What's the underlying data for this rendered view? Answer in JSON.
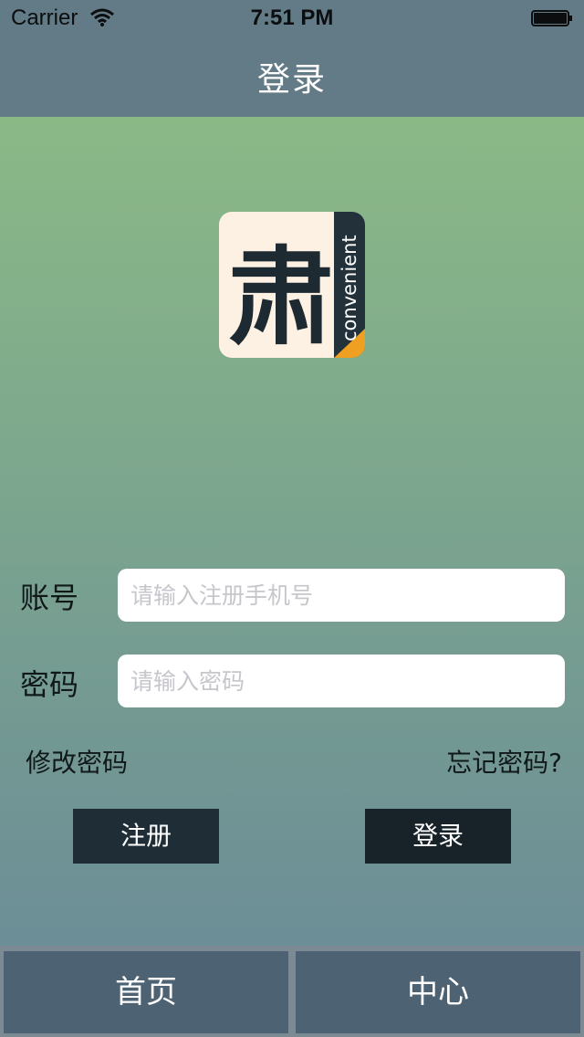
{
  "status_bar": {
    "carrier": "Carrier",
    "time": "7:51 PM"
  },
  "nav": {
    "title": "登录"
  },
  "logo": {
    "glyph": "肃",
    "word": "convenient"
  },
  "form": {
    "account_label": "账号",
    "account_placeholder": "请输入注册手机号",
    "password_label": "密码",
    "password_placeholder": "请输入密码",
    "change_password": "修改密码",
    "forgot_password": "忘记密码?",
    "register_button": "注册",
    "login_button": "登录"
  },
  "tabbar": {
    "home": "首页",
    "center": "中心"
  },
  "colors": {
    "nav_bg": "#627b86",
    "button_register": "#1f2e36",
    "button_login": "#182329",
    "tab_bg": "#4d6272",
    "logo_bg": "#fdf1e3",
    "logo_accent": "#f0a020"
  }
}
